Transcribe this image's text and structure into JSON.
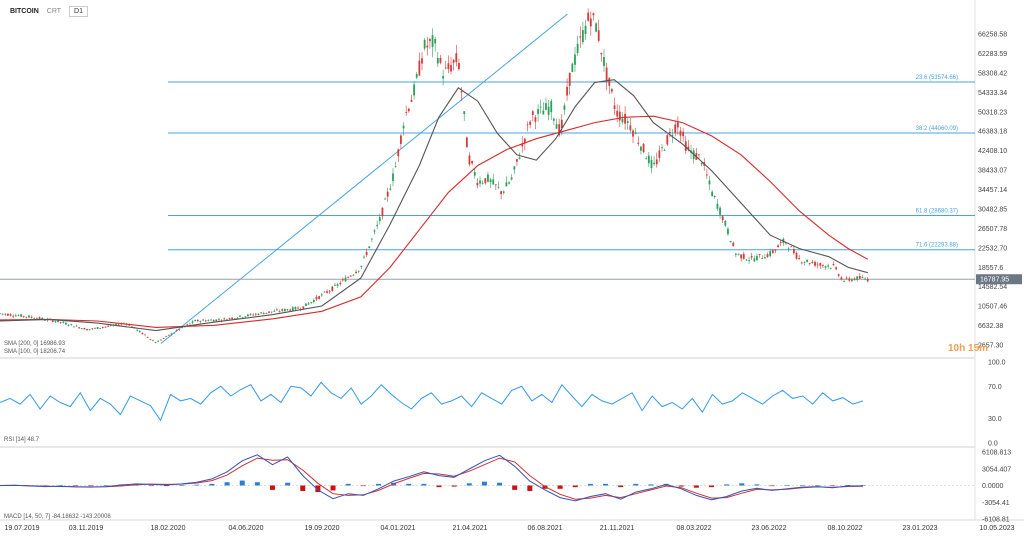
{
  "header": {
    "symbol": "BITCOIN",
    "sub": "CRT",
    "timeframe": "D1"
  },
  "countdown": "10h 15m",
  "colors": {
    "up": "#2aa05a",
    "down": "#d73a3a",
    "sma200": "#d62b2b",
    "sma100": "#555555",
    "fib": "#4aa3e0",
    "rsi": "#3399ee",
    "macd_line": "#3355bb",
    "macd_signal": "#cc3333",
    "hist_up": "#2a7fd0",
    "hist_down": "#cc1111",
    "last_price_bg": "#6b7785"
  },
  "chart_data": [
    {
      "type": "candlestick",
      "name": "price",
      "x_dates": [
        "19.07.2019",
        "03.11.2019",
        "18.02.2020",
        "04.06.2020",
        "19.09.2020",
        "04.01.2021",
        "21.04.2021",
        "06.08.2021",
        "21.11.2021",
        "08.03.2022",
        "23.06.2022",
        "08.10.2022",
        "23.01.2023",
        "10.05.2023"
      ],
      "y_ticks": [
        "66258.58",
        "62283.59",
        "58308.42",
        "54333.34",
        "50318.23",
        "46383.18",
        "42408.10",
        "38433.07",
        "34457.14",
        "30482.85",
        "26507.78",
        "22532.70",
        "18557.6",
        "14582.54",
        "10507.46",
        "6632.38",
        "2657.30"
      ],
      "ylim": [
        2657.3,
        66258.58
      ],
      "last_price": "16787.95",
      "path": [
        [
          0,
          10400
        ],
        [
          0.03,
          9800
        ],
        [
          0.06,
          8900
        ],
        [
          0.09,
          7400
        ],
        [
          0.13,
          8600
        ],
        [
          0.16,
          5000
        ],
        [
          0.2,
          9000
        ],
        [
          0.23,
          9300
        ],
        [
          0.27,
          10500
        ],
        [
          0.31,
          11500
        ],
        [
          0.345,
          15500
        ],
        [
          0.37,
          19000
        ],
        [
          0.39,
          28000
        ],
        [
          0.405,
          37000
        ],
        [
          0.415,
          47000
        ],
        [
          0.425,
          52000
        ],
        [
          0.435,
          60000
        ],
        [
          0.445,
          61000
        ],
        [
          0.455,
          55000
        ],
        [
          0.47,
          58000
        ],
        [
          0.48,
          40000
        ],
        [
          0.49,
          35000
        ],
        [
          0.5,
          35500
        ],
        [
          0.515,
          33000
        ],
        [
          0.525,
          35500
        ],
        [
          0.545,
          47000
        ],
        [
          0.565,
          49000
        ],
        [
          0.575,
          44000
        ],
        [
          0.585,
          55000
        ],
        [
          0.595,
          61000
        ],
        [
          0.605,
          66000
        ],
        [
          0.612,
          64000
        ],
        [
          0.622,
          55000
        ],
        [
          0.632,
          48000
        ],
        [
          0.645,
          46000
        ],
        [
          0.66,
          41000
        ],
        [
          0.67,
          37500
        ],
        [
          0.685,
          43000
        ],
        [
          0.695,
          46000
        ],
        [
          0.705,
          41000
        ],
        [
          0.72,
          39000
        ],
        [
          0.73,
          33000
        ],
        [
          0.74,
          29000
        ],
        [
          0.748,
          25000
        ],
        [
          0.755,
          21500
        ],
        [
          0.77,
          20500
        ],
        [
          0.79,
          21500
        ],
        [
          0.805,
          24000
        ],
        [
          0.82,
          20500
        ],
        [
          0.84,
          19500
        ],
        [
          0.855,
          19200
        ],
        [
          0.865,
          16500
        ],
        [
          0.88,
          17000
        ],
        [
          0.89,
          16800
        ]
      ],
      "sma200": [
        [
          0,
          9200
        ],
        [
          0.05,
          9300
        ],
        [
          0.1,
          9000
        ],
        [
          0.16,
          7800
        ],
        [
          0.22,
          8200
        ],
        [
          0.28,
          9400
        ],
        [
          0.33,
          10800
        ],
        [
          0.37,
          13500
        ],
        [
          0.4,
          19000
        ],
        [
          0.43,
          26000
        ],
        [
          0.46,
          33000
        ],
        [
          0.49,
          38000
        ],
        [
          0.52,
          41000
        ],
        [
          0.55,
          43000
        ],
        [
          0.58,
          44500
        ],
        [
          0.61,
          46000
        ],
        [
          0.64,
          47000
        ],
        [
          0.67,
          47200
        ],
        [
          0.7,
          46000
        ],
        [
          0.73,
          43500
        ],
        [
          0.76,
          40000
        ],
        [
          0.79,
          35000
        ],
        [
          0.82,
          29500
        ],
        [
          0.85,
          25000
        ],
        [
          0.87,
          22500
        ],
        [
          0.89,
          20500
        ]
      ],
      "sma100": [
        [
          0,
          9000
        ],
        [
          0.05,
          9300
        ],
        [
          0.1,
          8600
        ],
        [
          0.16,
          7200
        ],
        [
          0.22,
          8800
        ],
        [
          0.28,
          10200
        ],
        [
          0.33,
          11800
        ],
        [
          0.37,
          17000
        ],
        [
          0.4,
          27000
        ],
        [
          0.43,
          38000
        ],
        [
          0.45,
          47000
        ],
        [
          0.47,
          52500
        ],
        [
          0.49,
          50000
        ],
        [
          0.51,
          44000
        ],
        [
          0.53,
          40000
        ],
        [
          0.55,
          39000
        ],
        [
          0.57,
          43000
        ],
        [
          0.59,
          49000
        ],
        [
          0.61,
          53500
        ],
        [
          0.63,
          54000
        ],
        [
          0.65,
          51000
        ],
        [
          0.67,
          46000
        ],
        [
          0.7,
          42000
        ],
        [
          0.73,
          37000
        ],
        [
          0.76,
          31000
        ],
        [
          0.79,
          25000
        ],
        [
          0.82,
          22500
        ],
        [
          0.85,
          21000
        ],
        [
          0.87,
          19000
        ],
        [
          0.89,
          18000
        ]
      ],
      "trendline": [
        [
          0.165,
          4800
        ],
        [
          0.582,
          66258
        ]
      ],
      "fib_levels": [
        {
          "label": "23.6 (53574.66)",
          "value": 53574.66
        },
        {
          "label": "38.2 (44060.09)",
          "value": 44060.09
        },
        {
          "label": "61.8 (28680.37)",
          "value": 28680.37
        },
        {
          "label": "71.6 (22293.88)",
          "value": 22293.88
        }
      ],
      "legend": [
        "SMA [200, 0]  16986.93",
        "SMA [100, 0]  18206.74"
      ]
    },
    {
      "type": "line",
      "name": "RSI",
      "ylim": [
        0,
        100
      ],
      "y_ticks": [
        "100.0",
        "70.0",
        "30.0",
        "0.0"
      ],
      "legend": "RSI [14]  48.7",
      "values": [
        50,
        55,
        48,
        60,
        42,
        58,
        50,
        45,
        62,
        40,
        55,
        48,
        35,
        58,
        52,
        46,
        28,
        60,
        52,
        55,
        48,
        62,
        70,
        58,
        66,
        72,
        52,
        60,
        50,
        70,
        68,
        58,
        75,
        62,
        55,
        68,
        48,
        58,
        72,
        60,
        50,
        42,
        55,
        62,
        48,
        52,
        58,
        45,
        62,
        55,
        48,
        65,
        70,
        52,
        60,
        50,
        72,
        58,
        45,
        60,
        52,
        48,
        55,
        62,
        40,
        58,
        45,
        50,
        42,
        55,
        38,
        60,
        48,
        52,
        62,
        55,
        48,
        58,
        65,
        55,
        58,
        48,
        62,
        52,
        56,
        48,
        52
      ]
    },
    {
      "type": "bar_line",
      "name": "MACD",
      "ylim": [
        -6108.81,
        6108.813
      ],
      "y_ticks": [
        "6108.813",
        "3054.407",
        "0.0000",
        "-3054.41",
        "-6108.81"
      ],
      "legend": "MACD [14, 50, 7]  -84.18632  -143.20008",
      "line": [
        0,
        60,
        -100,
        -200,
        -150,
        -250,
        -300,
        -200,
        100,
        300,
        200,
        100,
        300,
        600,
        1200,
        2500,
        4500,
        5600,
        3800,
        5200,
        1800,
        -800,
        -2400,
        -1500,
        -1800,
        -600,
        800,
        1600,
        2500,
        1800,
        1500,
        3000,
        4500,
        5500,
        3500,
        800,
        -800,
        -2200,
        -2800,
        -2000,
        -1500,
        -2500,
        -1200,
        -600,
        200,
        -600,
        -1800,
        -2600,
        -2000,
        -1000,
        -500,
        -900,
        -600,
        -300,
        -200,
        -400,
        -100,
        -80
      ],
      "signal": [
        0,
        20,
        -50,
        -150,
        -180,
        -220,
        -260,
        -240,
        -100,
        150,
        250,
        200,
        250,
        450,
        900,
        1900,
        3600,
        5000,
        4600,
        4700,
        2800,
        400,
        -1500,
        -1800,
        -1700,
        -900,
        300,
        1300,
        2200,
        2100,
        1700,
        2600,
        3800,
        5000,
        4300,
        1800,
        -200,
        -1600,
        -2500,
        -2300,
        -1800,
        -2200,
        -1500,
        -800,
        -100,
        -400,
        -1400,
        -2300,
        -2200,
        -1400,
        -700,
        -800,
        -700,
        -400,
        -250,
        -350,
        -180,
        -140
      ],
      "hist": [
        0,
        40,
        -50,
        -50,
        30,
        -30,
        -40,
        40,
        200,
        150,
        -50,
        -100,
        50,
        150,
        300,
        600,
        900,
        600,
        -800,
        500,
        -1000,
        -1200,
        -900,
        300,
        -100,
        300,
        500,
        300,
        300,
        -300,
        -200,
        400,
        700,
        500,
        -800,
        -1000,
        -600,
        -600,
        -300,
        300,
        300,
        -300,
        300,
        200,
        300,
        -200,
        -400,
        -300,
        200,
        400,
        200,
        -100,
        100,
        100,
        50,
        -50,
        80,
        60
      ]
    }
  ]
}
